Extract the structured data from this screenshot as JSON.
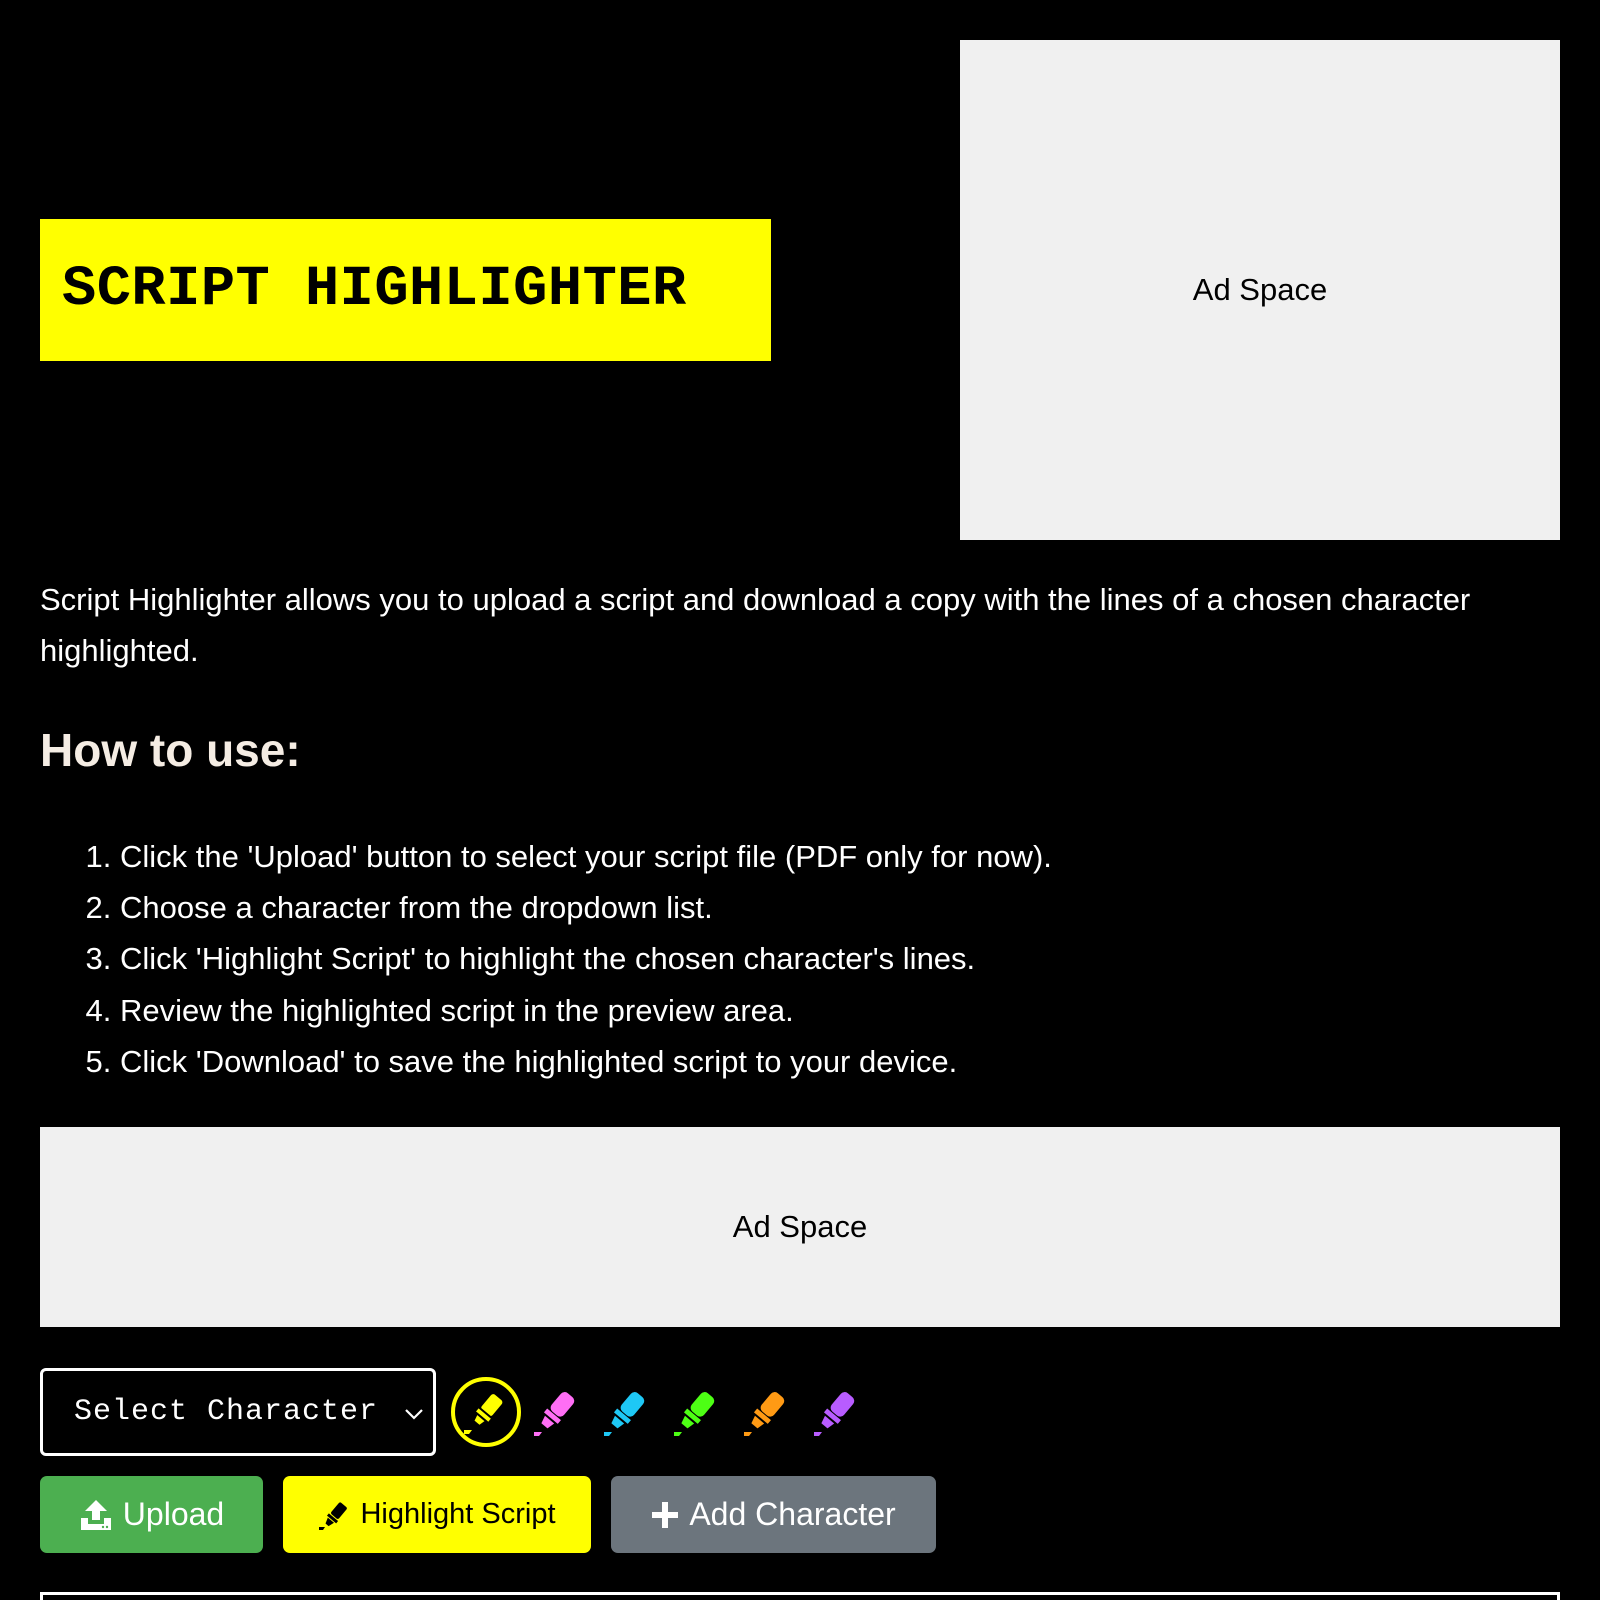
{
  "logo": {
    "title": "SCRIPT HIGHLIGHTER",
    "background_color": "#ffff00"
  },
  "ads": {
    "top_label": "Ad Space",
    "wide_label": "Ad Space"
  },
  "intro": {
    "text": "Script Highlighter allows you to upload a script and download a copy with the lines of a chosen character highlighted."
  },
  "howto": {
    "title": "How to use:",
    "steps": [
      "Click the 'Upload' button to select your script file (PDF only for now).",
      "Choose a character from the dropdown list.",
      "Click 'Highlight Script' to highlight the chosen character's lines.",
      "Review the highlighted script in the preview area.",
      "Click 'Download' to save the highlighted script to your device."
    ]
  },
  "controls": {
    "character_select": {
      "selected": "Select Character"
    },
    "highlighter_colors": [
      {
        "name": "yellow",
        "color": "#ffff00",
        "selected": true,
        "icon": "highlighter-icon"
      },
      {
        "name": "pink",
        "color": "#ff6ef5",
        "selected": false,
        "icon": "highlighter-icon"
      },
      {
        "name": "blue",
        "color": "#1ec8f5",
        "selected": false,
        "icon": "highlighter-icon"
      },
      {
        "name": "green",
        "color": "#4dff14",
        "selected": false,
        "icon": "highlighter-icon"
      },
      {
        "name": "orange",
        "color": "#ff9a14",
        "selected": false,
        "icon": "highlighter-icon"
      },
      {
        "name": "purple",
        "color": "#b85cff",
        "selected": false,
        "icon": "highlighter-icon"
      }
    ],
    "buttons": {
      "upload": {
        "label": "Upload",
        "icon": "upload-icon",
        "color": "#4caf50"
      },
      "highlight": {
        "label": "Highlight Script",
        "icon": "highlighter-icon",
        "color": "#ffff00"
      },
      "add_character": {
        "label": "Add Character",
        "icon": "plus-icon",
        "color": "#6c757d"
      }
    }
  }
}
